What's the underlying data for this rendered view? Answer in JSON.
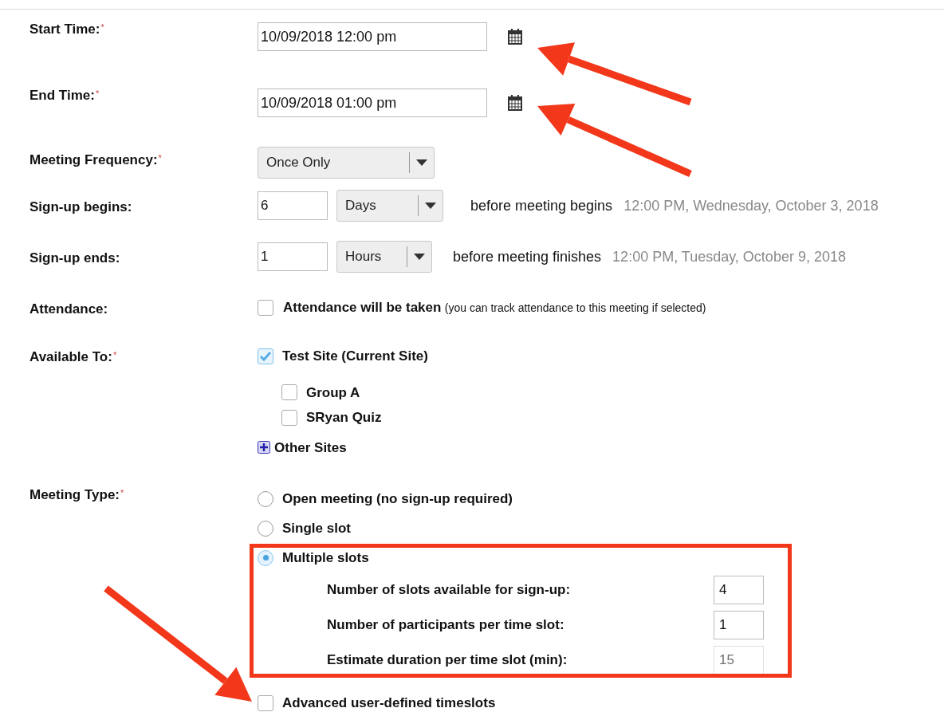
{
  "rows": [
    {
      "kind": "datetime",
      "label": "Start Time:",
      "required_mark": "*",
      "value": "10/09/2018 12:00 pm"
    },
    {
      "kind": "datetime",
      "label": "End Time:",
      "required_mark": "*",
      "value": "10/09/2018 01:00 pm"
    },
    {
      "kind": "select",
      "label": "Meeting Frequency:",
      "required_mark": "*",
      "value": "Once Only"
    },
    {
      "kind": "signup",
      "label": "Sign-up begins:",
      "number": "6",
      "unit": "Days",
      "relation": "before meeting begins",
      "computed": "12:00 PM, Wednesday, October 3, 2018"
    },
    {
      "kind": "signup",
      "label": "Sign-up ends:",
      "number": "1",
      "unit": "Hours",
      "relation": "before meeting finishes",
      "computed": "12:00 PM, Tuesday, October 9, 2018"
    },
    {
      "kind": "checkbox",
      "label": "Attendance:",
      "option": "Attendance will be taken",
      "note": "(you can track attendance to this meeting if selected)",
      "checked": false
    }
  ],
  "available_to": {
    "label": "Available To:",
    "required_mark": "*",
    "site": {
      "label": "Test Site (Current Site)",
      "checked": true
    },
    "groups": [
      {
        "label": "Group A",
        "checked": false
      },
      {
        "label": "SRyan Quiz",
        "checked": false
      }
    ],
    "other_sites": "Other Sites"
  },
  "meeting_type": {
    "label": "Meeting Type:",
    "required_mark": "*",
    "options": [
      {
        "label": "Open meeting (no sign-up required)",
        "selected": false
      },
      {
        "label": "Single slot",
        "selected": false
      },
      {
        "label": "Multiple slots",
        "selected": true
      }
    ],
    "slot_fields": [
      {
        "label": "Number of slots available for sign-up:",
        "value": "4",
        "disabled": false
      },
      {
        "label": "Number of participants per time slot:",
        "value": "1",
        "disabled": false
      },
      {
        "label": "Estimate duration per time slot (min):",
        "value": "15",
        "disabled": true
      }
    ],
    "advanced": {
      "label": "Advanced user-defined timeslots",
      "checked": false
    }
  }
}
